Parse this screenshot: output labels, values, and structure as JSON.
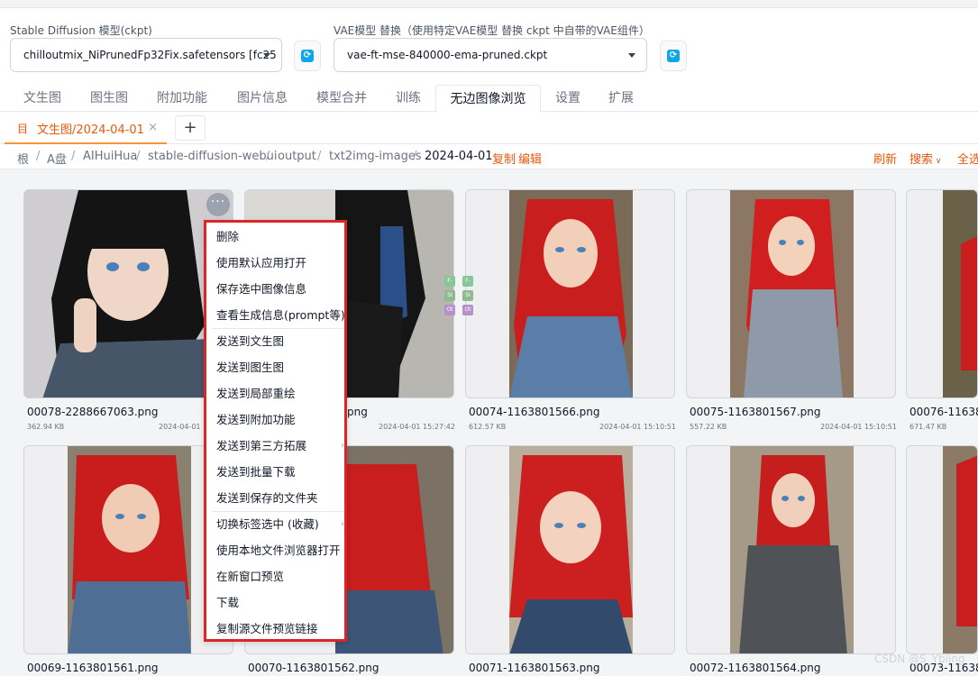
{
  "model": {
    "label": "Stable Diffusion 模型(ckpt)",
    "value": "chilloutmix_NiPrunedFp32Fix.safetensors [fc25"
  },
  "vae": {
    "label": "VAE模型 替换（使用特定VAE模型 替换 ckpt 中自带的VAE组件）",
    "value": "vae-ft-mse-840000-ema-pruned.ckpt"
  },
  "tabs": [
    "文生图",
    "图生图",
    "附加功能",
    "图片信息",
    "模型合并",
    "训练",
    "无边图像浏览",
    "设置",
    "扩展"
  ],
  "active_tab": "无边图像浏览",
  "inner_tab": {
    "icon": "目",
    "label": "文生图/2024-04-01",
    "close": "×",
    "add": "+"
  },
  "breadcrumb": [
    "根",
    "A盘",
    "AIHuiHua",
    "stable-diffusion-webui",
    "output",
    "txt2img-images",
    "2024-04-01"
  ],
  "breadcrumb_sep": "/",
  "crumb_actions": {
    "copy": "复制",
    "edit": "编辑"
  },
  "toolbar": {
    "refresh": "刷新",
    "search": "搜索",
    "select_all": "全选"
  },
  "more_button": "···",
  "images_row1": [
    {
      "name": "00078-2288667063.png",
      "size": "362.94 KB",
      "date": "2024-04-01 1"
    },
    {
      "name": "png",
      "size": "",
      "date": "2024-04-01 15:27:42"
    },
    {
      "name": "00074-1163801566.png",
      "size": "612.57 KB",
      "date": "2024-04-01 15:10:51"
    },
    {
      "name": "00075-1163801567.png",
      "size": "557.22 KB",
      "date": "2024-04-01 15:10:51"
    },
    {
      "name": "00076-11638",
      "size": "671.47 KB",
      "date": ""
    }
  ],
  "images_row2": [
    {
      "name": "00069-1163801561.png"
    },
    {
      "name": "00070-1163801562.png"
    },
    {
      "name": "00071-1163801563.png"
    },
    {
      "name": "00072-1163801564.png"
    },
    {
      "name": "00073-11638"
    }
  ],
  "menu": {
    "items": [
      "删除",
      "使用默认应用打开",
      "保存选中图像信息",
      "查看生成信息(prompt等)",
      "发送到文生图",
      "发送到图生图",
      "发送到局部重绘",
      "发送到附加功能",
      "发送到第三方拓展",
      "发送到批量下载",
      "发送到保存的文件夹",
      "切换标签选中 (收藏)",
      "使用本地文件浏览器打开",
      "在新窗口预览",
      "下载",
      "复制源文件预览链接"
    ],
    "submenu_arrow": "›"
  },
  "badges": [
    "F-",
    "F-",
    "SI",
    "SI",
    "Ot",
    "Ot"
  ],
  "watermark": "CSDN @S_Ybling",
  "colors": {
    "accent": "#ea580c",
    "menu_border": "#dc2626",
    "refresh_icon": "#0ea5e9"
  }
}
